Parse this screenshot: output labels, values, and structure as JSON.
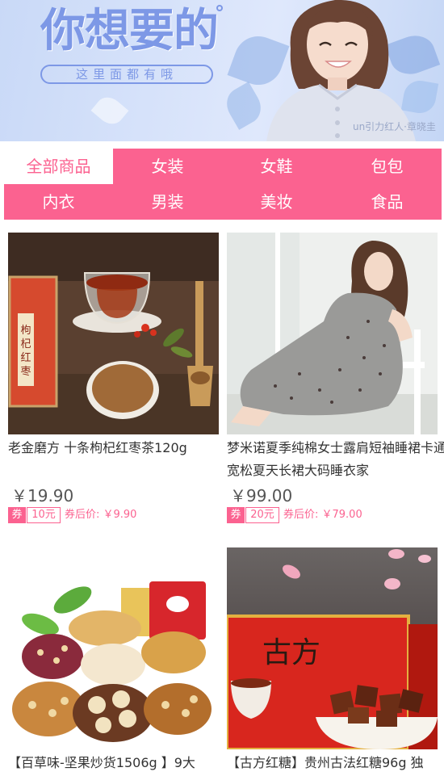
{
  "banner": {
    "title": "你想要的",
    "subtitle": "这里面都有哦",
    "credit": "un引力红人·章晓圭"
  },
  "tabs": [
    {
      "label": "全部商品",
      "active": true
    },
    {
      "label": "女装",
      "active": false
    },
    {
      "label": "女鞋",
      "active": false
    },
    {
      "label": "包包",
      "active": false
    },
    {
      "label": "内衣",
      "active": false
    },
    {
      "label": "男装",
      "active": false
    },
    {
      "label": "美妆",
      "active": false
    },
    {
      "label": "食品",
      "active": false
    }
  ],
  "products": [
    {
      "title": "老金磨方 十条枸杞红枣茶120g",
      "price": "￥19.90",
      "coupon_tag": "券",
      "coupon_amount": "10元",
      "after_coupon": "券后价: ￥9.90",
      "image_label": "枸杞红枣茶"
    },
    {
      "title": "梦米诺夏季纯棉女士露肩短袖睡裙卡通宽松夏天长裙大码睡衣家",
      "price": "￥99.00",
      "coupon_tag": "券",
      "coupon_amount": "20元",
      "after_coupon": "券后价: ￥79.00"
    },
    {
      "title": "【百草味-坚果炒货1506g 】9大"
    },
    {
      "title": "【古方红糖】贵州古法红糖96g 独",
      "image_label": "古方"
    }
  ],
  "colors": {
    "accent": "#fb6290",
    "banner_text": "#7d98e6"
  }
}
